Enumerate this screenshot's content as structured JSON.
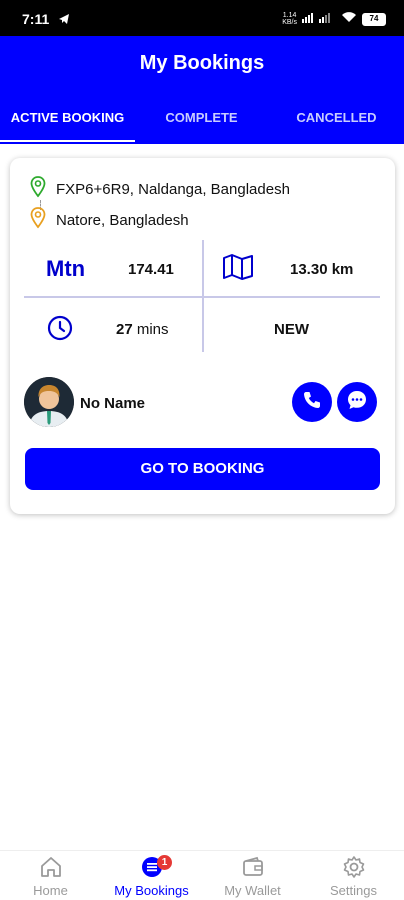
{
  "status_bar": {
    "time": "7:11",
    "speed": "1.14\nKB/s",
    "battery": "74"
  },
  "header": {
    "title": "My Bookings"
  },
  "tabs": [
    {
      "label": "ACTIVE BOOKING",
      "active": true
    },
    {
      "label": "COMPLETE",
      "active": false
    },
    {
      "label": "CANCELLED",
      "active": false
    }
  ],
  "booking": {
    "pickup": "FXP6+6R9, Naldanga, Bangladesh",
    "dropoff": "Natore, Bangladesh",
    "currency": "Mtn",
    "fare": "174.41",
    "distance": "13.30 km",
    "duration_value": "27",
    "duration_unit": " mins",
    "status": "NEW",
    "rider_name": "No Name",
    "go_button": "GO TO BOOKING"
  },
  "bottom_nav": [
    {
      "label": "Home",
      "icon": "home-icon"
    },
    {
      "label": "My Bookings",
      "icon": "bookings-icon",
      "badge": "1",
      "active": true
    },
    {
      "label": "My Wallet",
      "icon": "wallet-icon"
    },
    {
      "label": "Settings",
      "icon": "settings-icon"
    }
  ],
  "colors": {
    "primary": "#0000ff",
    "pickup_pin": "#2eaa2e",
    "dropoff_pin": "#e8a020",
    "badge": "#e53935"
  }
}
